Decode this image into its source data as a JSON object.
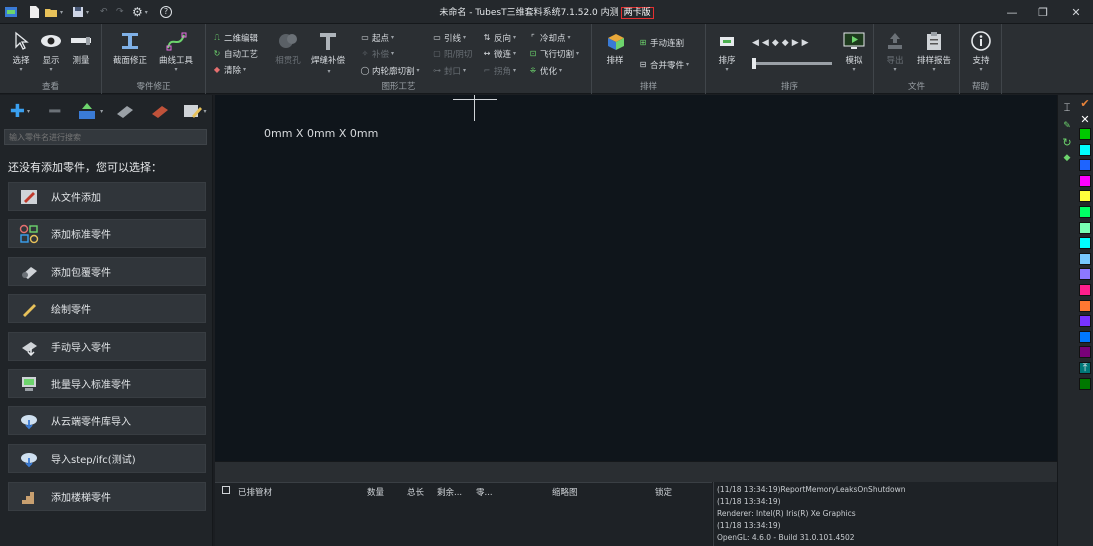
{
  "window": {
    "title": "未命名 - TubesT三维套料系统7.1.52.0 内测",
    "badge": "两卡版",
    "minimize": "—",
    "maximize": "❐",
    "close": "✕"
  },
  "quick_access": {
    "help": "?"
  },
  "ribbon": {
    "view_group": {
      "label": "查看",
      "select": "选择",
      "display": "显示",
      "measure": "测量"
    },
    "fix_group": {
      "label": "零件修正",
      "section_fix": "截面修正",
      "curve_tool": "曲线工具"
    },
    "process_group": {
      "label": "图形工艺",
      "edit2d": "二维编辑",
      "auto_process": "自动工艺",
      "clear": "清除",
      "contour": "相贯孔",
      "weld": "焊缝补偿",
      "start_point": "起点",
      "compensate": "补偿",
      "inner_cut": "内轮廓切割",
      "lead": "引线",
      "gap": "阳/阴切",
      "seal": "封口",
      "reverse": "反向",
      "micro_joint": "微连",
      "corner": "拐角",
      "cooling": "冷却点",
      "fly_cut": "飞行切割",
      "optimize": "优化"
    },
    "nest_group": {
      "label": "排样",
      "nest": "排样",
      "manual_joint": "手动连割",
      "merge_parts": "合并零件"
    },
    "sort_group": {
      "label": "排序",
      "sort": "排序",
      "simulate": "模拟"
    },
    "file_group": {
      "label": "文件",
      "export": "导出",
      "report": "排样报告"
    },
    "help_group": {
      "label": "帮助",
      "support": "支持"
    }
  },
  "left_panel": {
    "search_placeholder": "输入零件名进行搜索",
    "hint": "还没有添加零件，您可以选择：",
    "options": [
      {
        "label": "从文件添加",
        "icon": "file-add-icon"
      },
      {
        "label": "添加标准零件",
        "icon": "shapes-icon"
      },
      {
        "label": "添加包覆零件",
        "icon": "wrap-icon"
      },
      {
        "label": "绘制零件",
        "icon": "pencil-icon"
      },
      {
        "label": "手动导入零件",
        "icon": "import-icon"
      },
      {
        "label": "批量导入标准零件",
        "icon": "batch-import-icon"
      },
      {
        "label": "从云端零件库导入",
        "icon": "cloud-download-icon"
      },
      {
        "label": "导入step/ifc(测试)",
        "icon": "cloud-step-icon"
      },
      {
        "label": "添加楼梯零件",
        "icon": "stairs-icon"
      }
    ]
  },
  "canvas": {
    "dimensions": "0mm X 0mm X 0mm"
  },
  "table": {
    "columns": [
      "已排管材",
      "数量",
      "总长",
      "剩余...",
      "零...",
      "缩略图",
      "锁定"
    ]
  },
  "log": [
    "(11/18 13:34:19)ReportMemoryLeaksOnShutdown",
    "(11/18 13:34:19)",
    "Renderer: Intel(R) Iris(R) Xe Graphics",
    "(11/18 13:34:19)",
    "OpenGL: 4.6.0 - Build 31.0.101.4502"
  ],
  "palette": [
    "#00c800",
    "#00ffff",
    "#1e64ff",
    "#ff00ff",
    "#ffff3c",
    "#00ff64",
    "#78ffb4",
    "#00ffff",
    "#78c8ff",
    "#8c78ff",
    "#ff1e8c",
    "#ff7832",
    "#7832ff",
    "#0078ff",
    "#780078",
    "#007878",
    "#007800"
  ],
  "accent": {
    "badge_border": "#e23030",
    "check": "#e8833a"
  }
}
